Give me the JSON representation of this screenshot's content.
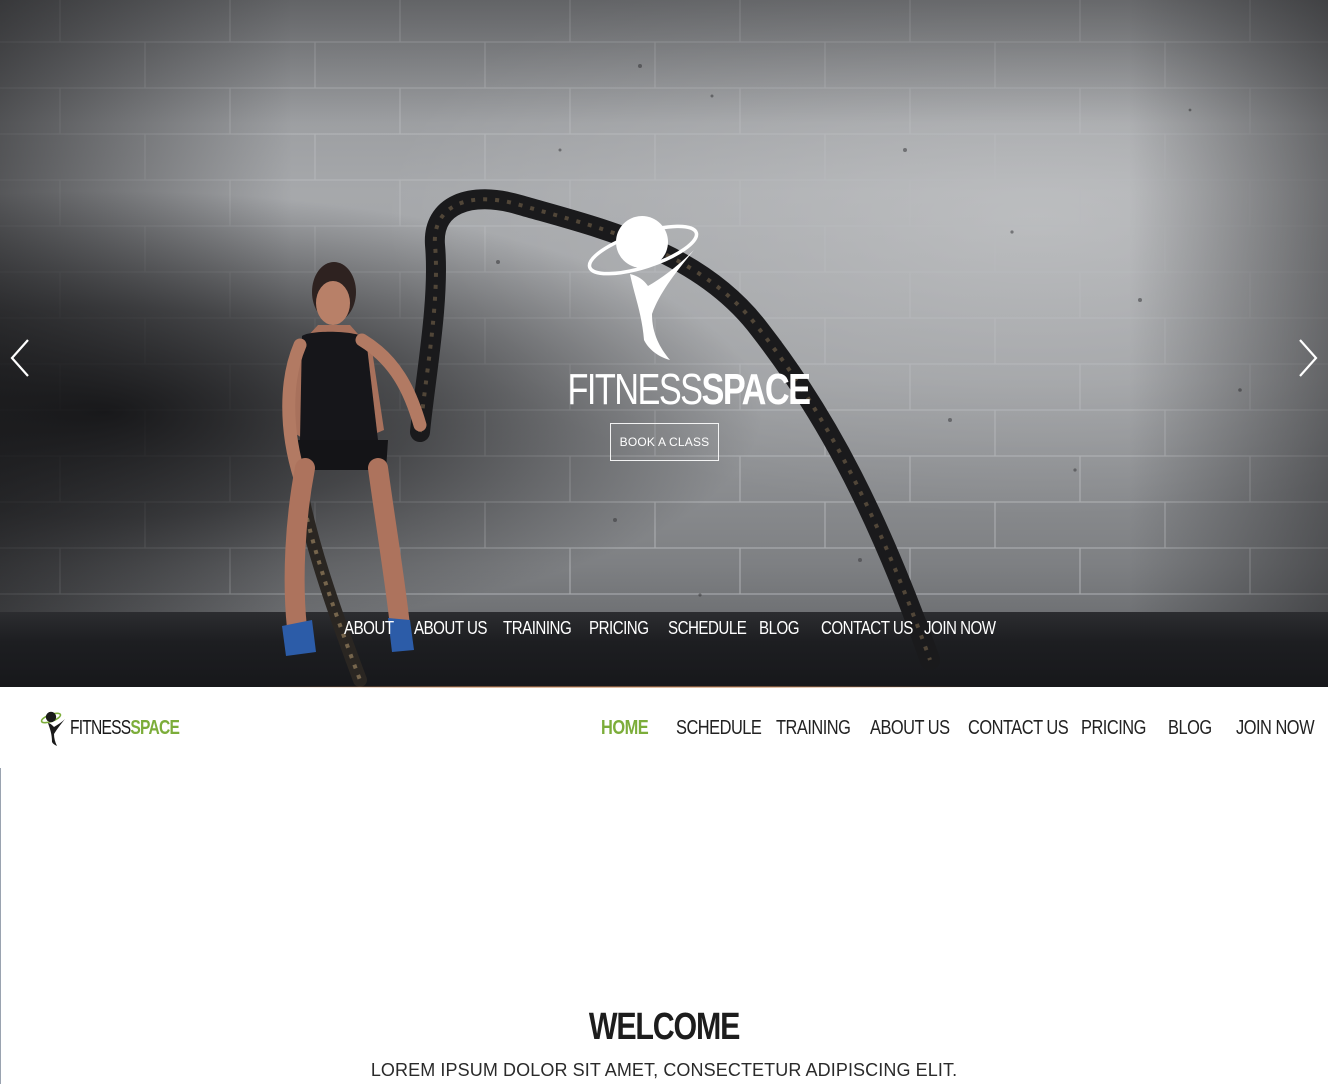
{
  "hero": {
    "brand_light": "FITNESS",
    "brand_bold": "SPACE",
    "book_button_label": "BOOK A CLASS",
    "prev_arrow_icon": "chevron-left-icon",
    "next_arrow_icon": "chevron-right-icon",
    "nav_items": [
      {
        "label": "ABOUT"
      },
      {
        "label": "ABOUT US"
      },
      {
        "label": "TRAINING"
      },
      {
        "label": "PRICING"
      },
      {
        "label": "SCHEDULE"
      },
      {
        "label": "BLOG"
      },
      {
        "label": "CONTACT US"
      },
      {
        "label": "JOIN NOW"
      }
    ]
  },
  "header": {
    "logo_light": "FITNESS",
    "logo_bold": "SPACE",
    "logo_icon": "fitness-figure-icon",
    "nav_items": [
      {
        "label": "HOME",
        "active": true
      },
      {
        "label": "SCHEDULE",
        "active": false
      },
      {
        "label": "TRAINING",
        "active": false
      },
      {
        "label": "ABOUT US",
        "active": false
      },
      {
        "label": "CONTACT US",
        "active": false
      },
      {
        "label": "PRICING",
        "active": false
      },
      {
        "label": "BLOG",
        "active": false
      },
      {
        "label": "JOIN NOW",
        "active": false
      }
    ]
  },
  "welcome": {
    "title": "WELCOME",
    "subtitle": "LOREM IPSUM DOLOR SIT AMET, CONSECTETUR ADIPISCING ELIT."
  },
  "colors": {
    "accent_green": "#7cad3a",
    "text_dark": "#222222",
    "hero_text": "#ffffff"
  }
}
